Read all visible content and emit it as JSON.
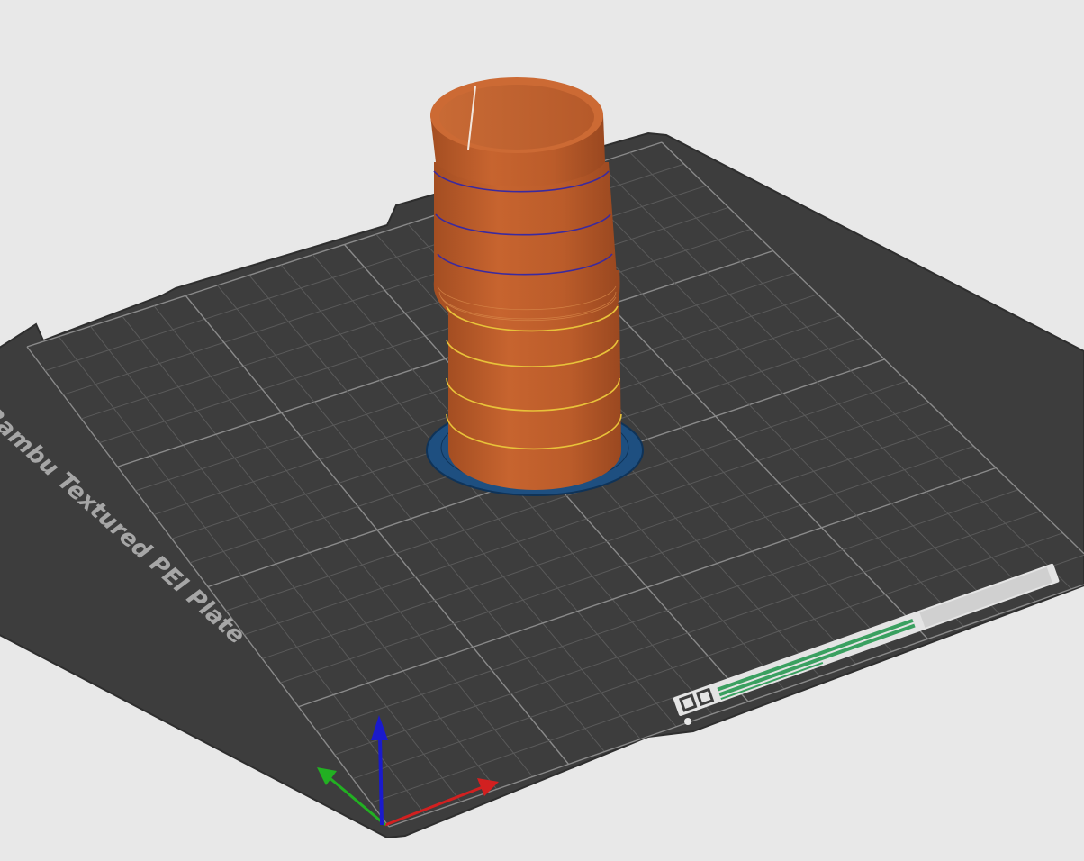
{
  "plate": {
    "label": "Bambu Textured PEI Plate",
    "color": "#3d3d3d",
    "edge_color": "#2e2e2e",
    "grid_color": "#5a5a5a",
    "grid_major_color": "#8a8a8a",
    "label_color": "#a6a6a6"
  },
  "model": {
    "color": "#b95c2a",
    "shade_color": "#8e4420",
    "highlight_color": "#cc6a34",
    "layer_line_upper_color": "#3a2aa0",
    "layer_line_lower_color": "#e8c23a",
    "brim_color": "#1e4f80",
    "brim_outline_color": "#0f3358"
  },
  "axes": {
    "x_color": "#d22020",
    "y_color": "#22b022",
    "z_color": "#1a1acc"
  },
  "viewport": {
    "background": "#e8e8e8"
  }
}
